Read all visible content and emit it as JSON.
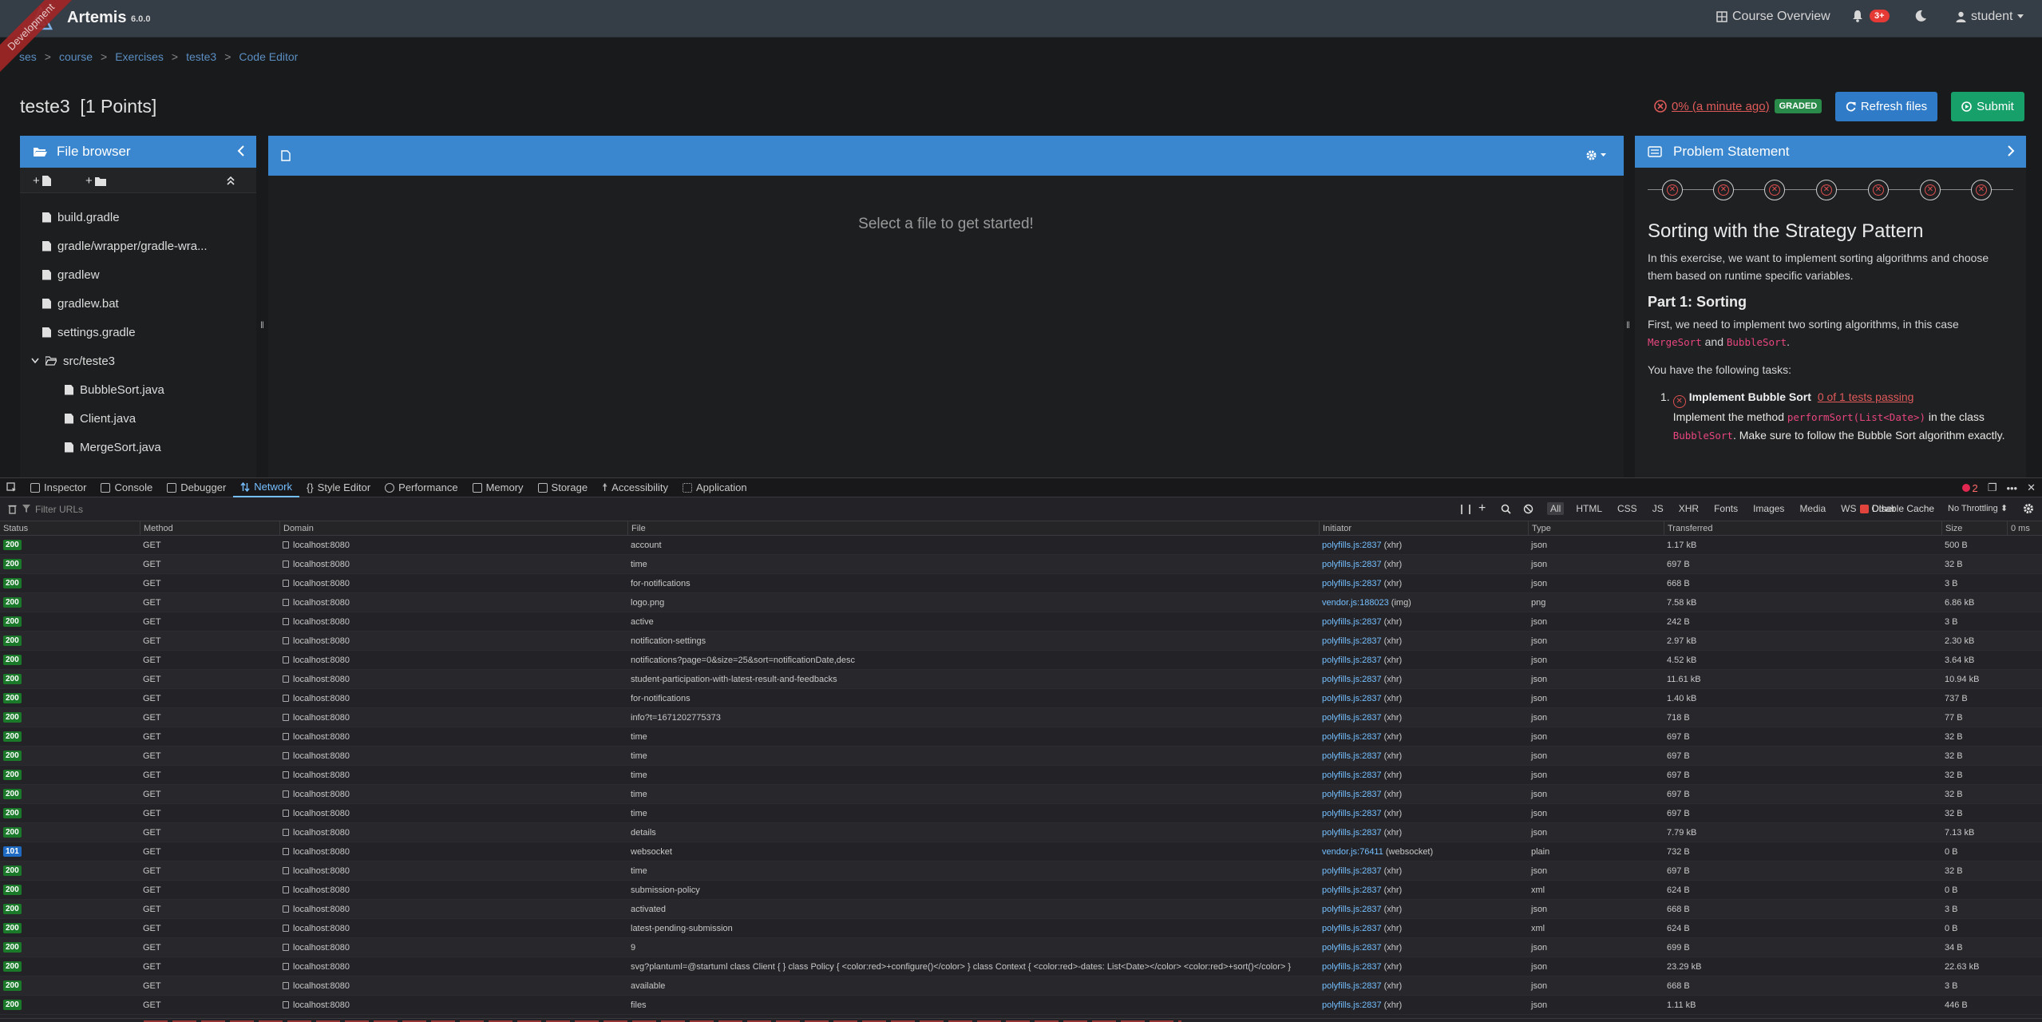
{
  "navbar": {
    "brand": "Artemis",
    "version": "6.0.0",
    "ribbon": "Development",
    "course_overview": "Course Overview",
    "notifications_badge": "3+",
    "user": "student"
  },
  "breadcrumb": [
    "ses",
    "course",
    "Exercises",
    "teste3",
    "Code Editor"
  ],
  "page": {
    "title": "teste3  [1 Points]",
    "result_text": "0% (a minute ago)",
    "graded": "GRADED",
    "refresh_label": "Refresh files",
    "submit_label": "Submit"
  },
  "file_browser": {
    "title": "File browser",
    "items": [
      {
        "label": "build.gradle",
        "level": 0,
        "kind": "file"
      },
      {
        "label": "gradle/wrapper/gradle-wra...",
        "level": 0,
        "kind": "file"
      },
      {
        "label": "gradlew",
        "level": 0,
        "kind": "file"
      },
      {
        "label": "gradlew.bat",
        "level": 0,
        "kind": "file"
      },
      {
        "label": "settings.gradle",
        "level": 0,
        "kind": "file"
      },
      {
        "label": "src/teste3",
        "level": 0,
        "kind": "folder"
      },
      {
        "label": "BubbleSort.java",
        "level": 1,
        "kind": "file"
      },
      {
        "label": "Client.java",
        "level": 1,
        "kind": "file"
      },
      {
        "label": "MergeSort.java",
        "level": 1,
        "kind": "file"
      }
    ]
  },
  "editor": {
    "empty_message": "Select a file to get started!"
  },
  "problem_statement": {
    "header": "Problem Statement",
    "title": "Sorting with the Strategy Pattern",
    "intro": "In this exercise, we want to implement sorting algorithms and choose them based on runtime specific variables.",
    "part1_title": "Part 1: Sorting",
    "part1_text_a": "First, we need to implement two sorting algorithms, in this case",
    "code_merge": "MergeSort",
    "and": "and",
    "code_bubble": "BubbleSort",
    "period": ".",
    "tasks_intro": "You have the following tasks:",
    "task_num": "1.",
    "task_title": "Implement Bubble Sort",
    "task_tests": "0 of 1 tests passing",
    "task_text_a": "Implement the method",
    "task_code_method": "performSort(List<Date>)",
    "task_text_b": "in the class",
    "task_code_class": "BubbleSort",
    "task_text_c": ". Make sure to follow the Bubble Sort algorithm exactly."
  },
  "devtools": {
    "tabs": [
      "Inspector",
      "Console",
      "Debugger",
      "Network",
      "Style Editor",
      "Performance",
      "Memory",
      "Storage",
      "Accessibility",
      "Application"
    ],
    "active_tab": "Network",
    "error_count": "2",
    "filter_placeholder": "Filter URLs",
    "type_filters": [
      "All",
      "HTML",
      "CSS",
      "JS",
      "XHR",
      "Fonts",
      "Images",
      "Media",
      "WS",
      "Other"
    ],
    "disable_cache": "Disable Cache",
    "throttling": "No Throttling ⬍",
    "columns": [
      "Status",
      "Method",
      "Domain",
      "File",
      "Initiator",
      "Type",
      "Transferred",
      "Size",
      "0 ms"
    ],
    "rows": [
      {
        "status": "200",
        "method": "GET",
        "domain": "localhost:8080",
        "file": "account",
        "init": "polyfills.js:2837",
        "kind": "(xhr)",
        "type": "json",
        "transferred": "1.17 kB",
        "size": "500 B"
      },
      {
        "status": "200",
        "method": "GET",
        "domain": "localhost:8080",
        "file": "time",
        "init": "polyfills.js:2837",
        "kind": "(xhr)",
        "type": "json",
        "transferred": "697 B",
        "size": "32 B"
      },
      {
        "status": "200",
        "method": "GET",
        "domain": "localhost:8080",
        "file": "for-notifications",
        "init": "polyfills.js:2837",
        "kind": "(xhr)",
        "type": "json",
        "transferred": "668 B",
        "size": "3 B"
      },
      {
        "status": "200",
        "method": "GET",
        "domain": "localhost:8080",
        "file": "logo.png",
        "init": "vendor.js:188023",
        "kind": "(img)",
        "type": "png",
        "transferred": "7.58 kB",
        "size": "6.86 kB"
      },
      {
        "status": "200",
        "method": "GET",
        "domain": "localhost:8080",
        "file": "active",
        "init": "polyfills.js:2837",
        "kind": "(xhr)",
        "type": "json",
        "transferred": "242 B",
        "size": "3 B"
      },
      {
        "status": "200",
        "method": "GET",
        "domain": "localhost:8080",
        "file": "notification-settings",
        "init": "polyfills.js:2837",
        "kind": "(xhr)",
        "type": "json",
        "transferred": "2.97 kB",
        "size": "2.30 kB"
      },
      {
        "status": "200",
        "method": "GET",
        "domain": "localhost:8080",
        "file": "notifications?page=0&size=25&sort=notificationDate,desc",
        "init": "polyfills.js:2837",
        "kind": "(xhr)",
        "type": "json",
        "transferred": "4.52 kB",
        "size": "3.64 kB"
      },
      {
        "status": "200",
        "method": "GET",
        "domain": "localhost:8080",
        "file": "student-participation-with-latest-result-and-feedbacks",
        "init": "polyfills.js:2837",
        "kind": "(xhr)",
        "type": "json",
        "transferred": "11.61 kB",
        "size": "10.94 kB"
      },
      {
        "status": "200",
        "method": "GET",
        "domain": "localhost:8080",
        "file": "for-notifications",
        "init": "polyfills.js:2837",
        "kind": "(xhr)",
        "type": "json",
        "transferred": "1.40 kB",
        "size": "737 B"
      },
      {
        "status": "200",
        "method": "GET",
        "domain": "localhost:8080",
        "file": "info?t=1671202775373",
        "init": "polyfills.js:2837",
        "kind": "(xhr)",
        "type": "json",
        "transferred": "718 B",
        "size": "77 B"
      },
      {
        "status": "200",
        "method": "GET",
        "domain": "localhost:8080",
        "file": "time",
        "init": "polyfills.js:2837",
        "kind": "(xhr)",
        "type": "json",
        "transferred": "697 B",
        "size": "32 B"
      },
      {
        "status": "200",
        "method": "GET",
        "domain": "localhost:8080",
        "file": "time",
        "init": "polyfills.js:2837",
        "kind": "(xhr)",
        "type": "json",
        "transferred": "697 B",
        "size": "32 B"
      },
      {
        "status": "200",
        "method": "GET",
        "domain": "localhost:8080",
        "file": "time",
        "init": "polyfills.js:2837",
        "kind": "(xhr)",
        "type": "json",
        "transferred": "697 B",
        "size": "32 B"
      },
      {
        "status": "200",
        "method": "GET",
        "domain": "localhost:8080",
        "file": "time",
        "init": "polyfills.js:2837",
        "kind": "(xhr)",
        "type": "json",
        "transferred": "697 B",
        "size": "32 B"
      },
      {
        "status": "200",
        "method": "GET",
        "domain": "localhost:8080",
        "file": "time",
        "init": "polyfills.js:2837",
        "kind": "(xhr)",
        "type": "json",
        "transferred": "697 B",
        "size": "32 B"
      },
      {
        "status": "200",
        "method": "GET",
        "domain": "localhost:8080",
        "file": "details",
        "init": "polyfills.js:2837",
        "kind": "(xhr)",
        "type": "json",
        "transferred": "7.79 kB",
        "size": "7.13 kB"
      },
      {
        "status": "101",
        "method": "GET",
        "domain": "localhost:8080",
        "file": "websocket",
        "init": "vendor.js:76411",
        "kind": "(websocket)",
        "type": "plain",
        "transferred": "732 B",
        "size": "0 B"
      },
      {
        "status": "200",
        "method": "GET",
        "domain": "localhost:8080",
        "file": "time",
        "init": "polyfills.js:2837",
        "kind": "(xhr)",
        "type": "json",
        "transferred": "697 B",
        "size": "32 B"
      },
      {
        "status": "200",
        "method": "GET",
        "domain": "localhost:8080",
        "file": "submission-policy",
        "init": "polyfills.js:2837",
        "kind": "(xhr)",
        "type": "xml",
        "transferred": "624 B",
        "size": "0 B"
      },
      {
        "status": "200",
        "method": "GET",
        "domain": "localhost:8080",
        "file": "activated",
        "init": "polyfills.js:2837",
        "kind": "(xhr)",
        "type": "json",
        "transferred": "668 B",
        "size": "3 B"
      },
      {
        "status": "200",
        "method": "GET",
        "domain": "localhost:8080",
        "file": "latest-pending-submission",
        "init": "polyfills.js:2837",
        "kind": "(xhr)",
        "type": "xml",
        "transferred": "624 B",
        "size": "0 B"
      },
      {
        "status": "200",
        "method": "GET",
        "domain": "localhost:8080",
        "file": "9",
        "init": "polyfills.js:2837",
        "kind": "(xhr)",
        "type": "json",
        "transferred": "699 B",
        "size": "34 B"
      },
      {
        "status": "200",
        "method": "GET",
        "domain": "localhost:8080",
        "file": "svg?plantuml=@startuml class Client { } class Policy { <color:red>+configure()</color> } class Context { <color:red>-dates: List<Date></color> <color:red>+sort()</color> }",
        "init": "polyfills.js:2837",
        "kind": "(xhr)",
        "type": "json",
        "transferred": "23.29 kB",
        "size": "22.63 kB"
      },
      {
        "status": "200",
        "method": "GET",
        "domain": "localhost:8080",
        "file": "available",
        "init": "polyfills.js:2837",
        "kind": "(xhr)",
        "type": "json",
        "transferred": "668 B",
        "size": "3 B"
      },
      {
        "status": "200",
        "method": "GET",
        "domain": "localhost:8080",
        "file": "files",
        "init": "polyfills.js:2837",
        "kind": "(xhr)",
        "type": "json",
        "transferred": "1.11 kB",
        "size": "446 B"
      }
    ]
  }
}
